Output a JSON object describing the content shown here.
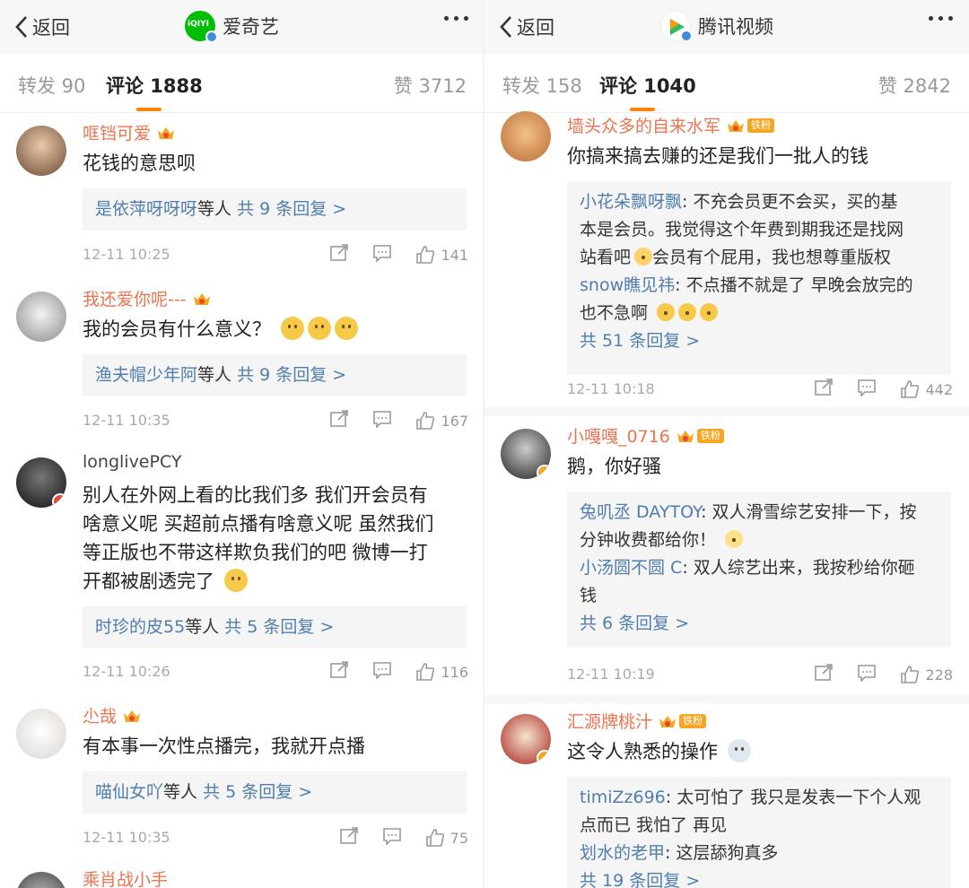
{
  "left": {
    "back_label": "返回",
    "app_name": "爱奇艺",
    "app_logo_text": "iQIYI",
    "tabs": {
      "repost": "转发 90",
      "comments": "评论 1888",
      "likes": "赞 3712"
    },
    "comments": [
      {
        "user": "哐铛可爱",
        "text": "花钱的意思呗",
        "reply_summary": {
          "names": "是依萍呀呀呀",
          "suffix": "等人",
          "count": "共 9 条回复 >"
        },
        "time": "12-11 10:25",
        "likes": "141"
      },
      {
        "user": "我还爱你呢---",
        "text": "我的会员有什么意义？",
        "emoji_count": 3,
        "reply_summary": {
          "names": "渔夫帽少年阿",
          "suffix": "等人",
          "count": "共 9 条回复 >"
        },
        "time": "12-11 10:35",
        "likes": "167"
      },
      {
        "user": "longlivePCY",
        "text_lines": [
          "别人在外网上看的比我们多  我们开会员有",
          "啥意义呢  买超前点播有啥意义呢  虽然我们",
          "等正版也不带这样欺负我们的吧  微博一打",
          "开都被剧透完了"
        ],
        "reply_summary": {
          "names": "时珍的皮55",
          "suffix": "等人",
          "count": "共 5 条回复 >"
        },
        "time": "12-11 10:26",
        "likes": "116"
      },
      {
        "user": "尐哉",
        "text": "有本事一次性点播完，我就开点播",
        "reply_summary": {
          "names": "喵仙女吖",
          "suffix": "等人",
          "count": "共 5 条回复 >"
        },
        "time": "12-11 10:35",
        "likes": "75"
      },
      {
        "user": "乘肖战小手"
      }
    ]
  },
  "right": {
    "back_label": "返回",
    "app_name": "腾讯视频",
    "tabs": {
      "repost": "转发 158",
      "comments": "评论 1040",
      "likes": "赞 2842"
    },
    "comments": [
      {
        "user": "墙头众多的自来水军",
        "badge": "铁粉",
        "text": "你搞来搞去赚的还是我们一批人的钱",
        "replies": [
          {
            "name": "小花朵飘呀飘",
            "lines": [
              "不充会员更不会买，买的基",
              "本是会员。我觉得这个年费到期我还是找网",
              "站看吧",
              "会员有个屁用，我也想尊重版权"
            ]
          },
          {
            "name": "snow瞧见祎",
            "lines": [
              "不点播不就是了 早晚会放完的",
              "也不急啊"
            ]
          }
        ],
        "more": "共 51 条回复 >",
        "time": "12-11 10:18",
        "likes": "442"
      },
      {
        "user": "小嘎嘎_0716",
        "badge": "铁粉",
        "text": "鹅，你好骚",
        "replies": [
          {
            "name": "兔叽丞 DAYTOY",
            "lines": [
              "双人滑雪综艺安排一下，按",
              "分钟收费都给你！"
            ]
          },
          {
            "name": "小汤圆不圆 C",
            "lines": [
              "双人综艺出来，我按秒给你砸",
              "钱"
            ]
          }
        ],
        "more": "共 6 条回复 >",
        "time": "12-11 10:19",
        "likes": "228"
      },
      {
        "user": "汇源牌桃汁",
        "badge": "铁粉",
        "text": "这令人熟悉的操作",
        "replies": [
          {
            "name": "timiZz696",
            "lines": [
              "太可怕了 我只是发表一下个人观",
              "点而已 我怕了 再见"
            ]
          },
          {
            "name": "划水的老甲",
            "lines": [
              "这层舔狗真多"
            ]
          }
        ],
        "more": "共 19 条回复 >"
      }
    ]
  },
  "colors": {
    "username": "#eb7350",
    "link": "#507daf",
    "accent": "#ff8200",
    "muted": "#aaaaaa"
  }
}
